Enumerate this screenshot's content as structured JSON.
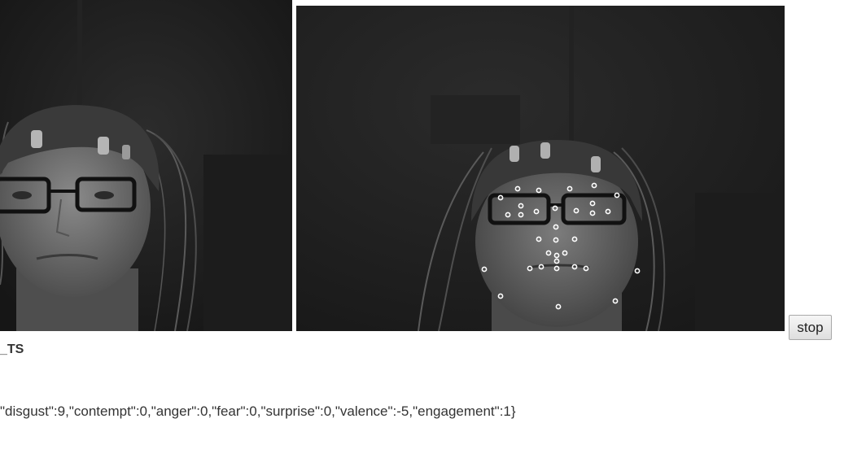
{
  "controls": {
    "stop_label": "stop"
  },
  "results": {
    "heading": "_TS",
    "json_text": "\"disgust\":9,\"contempt\":0,\"anger\":0,\"fear\":0,\"surprise\":0,\"valence\":-5,\"engagement\":1}"
  },
  "icons": {
    "face_landmark_marker": "landmark-dot-icon"
  }
}
